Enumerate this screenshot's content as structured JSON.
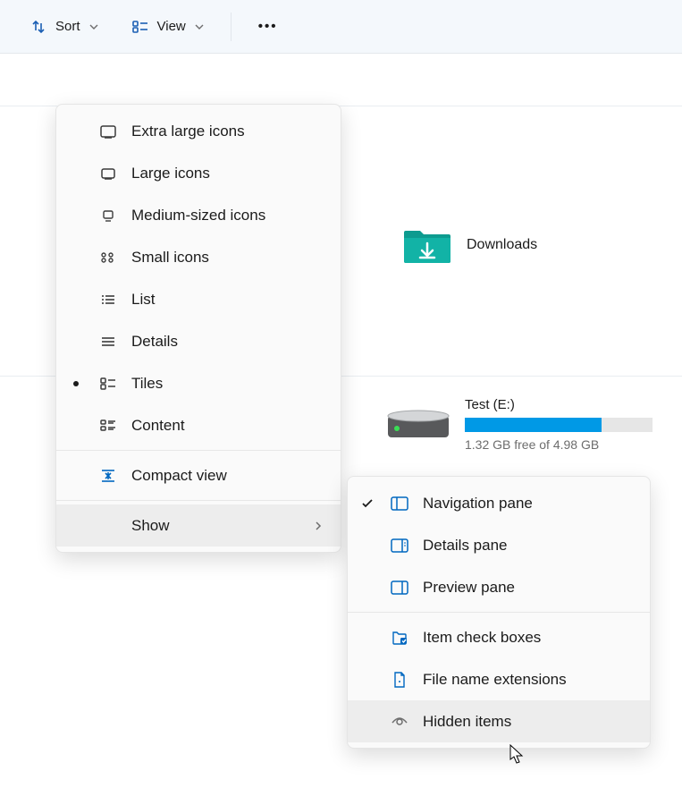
{
  "toolbar": {
    "sort_label": "Sort",
    "view_label": "View",
    "more_label": "•••"
  },
  "folders": {
    "downloads": "Downloads"
  },
  "drive": {
    "name": "Test (E:)",
    "free_text": "1.32 GB free of 4.98 GB",
    "used_percent": 73
  },
  "view_menu": {
    "extra_large": "Extra large icons",
    "large": "Large icons",
    "medium": "Medium-sized icons",
    "small": "Small icons",
    "list": "List",
    "details": "Details",
    "tiles": "Tiles",
    "content": "Content",
    "compact": "Compact view",
    "show": "Show"
  },
  "show_menu": {
    "navigation": "Navigation pane",
    "details": "Details pane",
    "preview": "Preview pane",
    "checkboxes": "Item check boxes",
    "extensions": "File name extensions",
    "hidden": "Hidden items"
  }
}
